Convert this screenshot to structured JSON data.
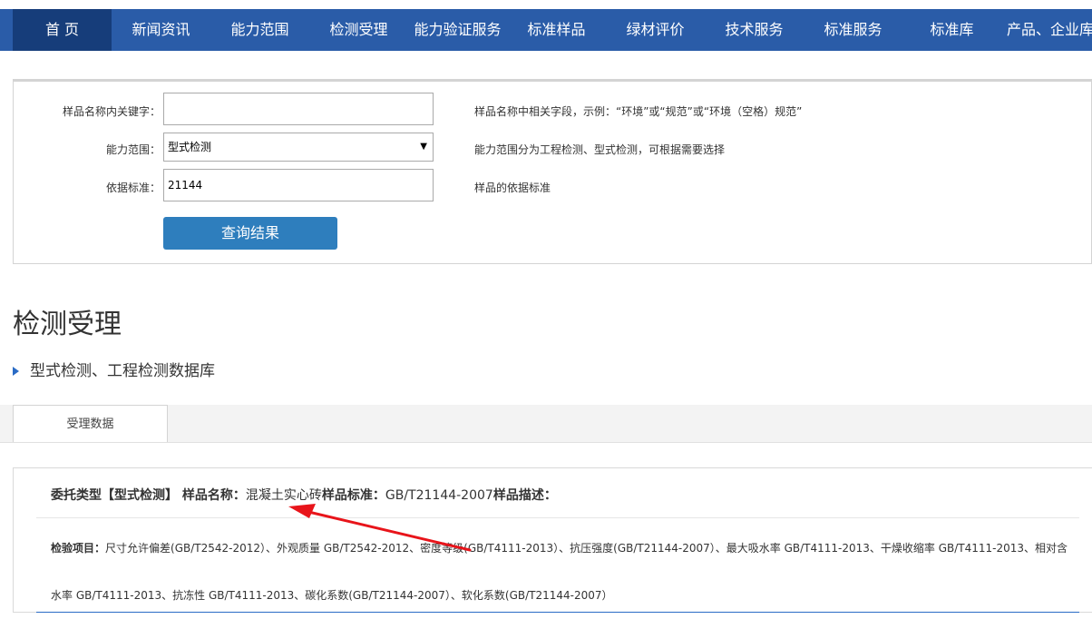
{
  "nav": {
    "items": [
      {
        "label": "首 页"
      },
      {
        "label": "新闻资讯"
      },
      {
        "label": "能力范围"
      },
      {
        "label": "检测受理"
      },
      {
        "label": "能力验证服务"
      },
      {
        "label": "标准样品"
      },
      {
        "label": "绿材评价"
      },
      {
        "label": "技术服务"
      },
      {
        "label": "标准服务"
      },
      {
        "label": "标准库"
      },
      {
        "label": "产品、企业库"
      }
    ]
  },
  "search": {
    "keyword_label": "样品名称内关键字：",
    "keyword_value": "",
    "keyword_hint": "样品名称中相关字段，示例：“环境”或“规范”或“环境（空格）规范”",
    "scope_label": "能力范围：",
    "scope_value": "型式检测",
    "scope_hint": "能力范围分为工程检测、型式检测，可根据需要选择",
    "standard_label": "依据标准：",
    "standard_value": "21144",
    "standard_hint": "样品的依据标准",
    "query_button": "查询结果"
  },
  "page": {
    "title": "检测受理",
    "subnav": "型式检测、工程检测数据库"
  },
  "tabs": [
    {
      "label": "受理数据"
    }
  ],
  "result": {
    "type_label": "委托类型【型式检测】 样品名称：",
    "sample_name": "混凝土实心砖",
    "standard_label": "样品标准：",
    "standard_value": "GB/T21144-2007",
    "desc_label": "样品描述：",
    "items_label": "检验项目：",
    "items_text": "尺寸允许偏差(GB/T2542-2012）、外观质量 GB/T2542-2012、密度等级(GB/T4111-2013）、抗压强度(GB/T21144-2007）、最大吸水率 GB/T4111-2013、干燥收缩率 GB/T4111-2013、相对含水率 GB/T4111-2013、抗冻性 GB/T4111-2013、碳化系数(GB/T21144-2007）、软化系数(GB/T21144-2007）"
  },
  "colors": {
    "nav_bg": "#2a5ca8",
    "nav_active": "#163d7a",
    "button_bg": "#2e7ebd",
    "annotation_arrow": "#e8141a"
  }
}
